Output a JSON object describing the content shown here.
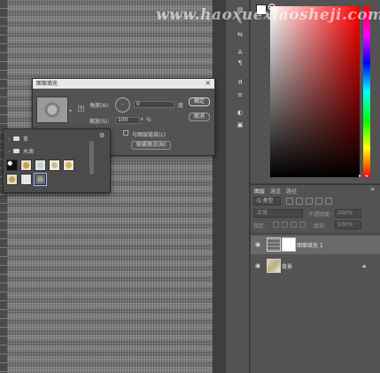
{
  "watermark": "www.haoxuexiaosheji.com",
  "dialog": {
    "title": "图案填充",
    "close": "×",
    "angle_label": "角度(A):",
    "angle_value": "0",
    "angle_unit": "度",
    "scale_label": "缩放(S):",
    "scale_value": "100",
    "scale_unit": "%",
    "link_label": "与图层链接(L)",
    "snap_label": "贴紧原点(N)",
    "ok_label": "确定",
    "cancel_label": "取消"
  },
  "pattern_picker": {
    "folders": [
      {
        "label": "草"
      },
      {
        "label": "水滴"
      }
    ]
  },
  "layers": {
    "tabs": [
      "图层",
      "通道",
      "路径"
    ],
    "kind": "Q 类型",
    "blend_mode": "正常",
    "opacity_label": "不透明度:",
    "opacity_value": "100%",
    "lock_label": "锁定:",
    "fill_label": "填充:",
    "fill_value": "100%",
    "items": [
      {
        "name": "图案填充 1",
        "selected": true
      },
      {
        "name": "背景",
        "locked": true
      }
    ]
  },
  "colors": {
    "accent_highlight": "#9ac0ff",
    "panel_bg": "#535353",
    "dialog_titlebar": "#e8e8e8"
  }
}
